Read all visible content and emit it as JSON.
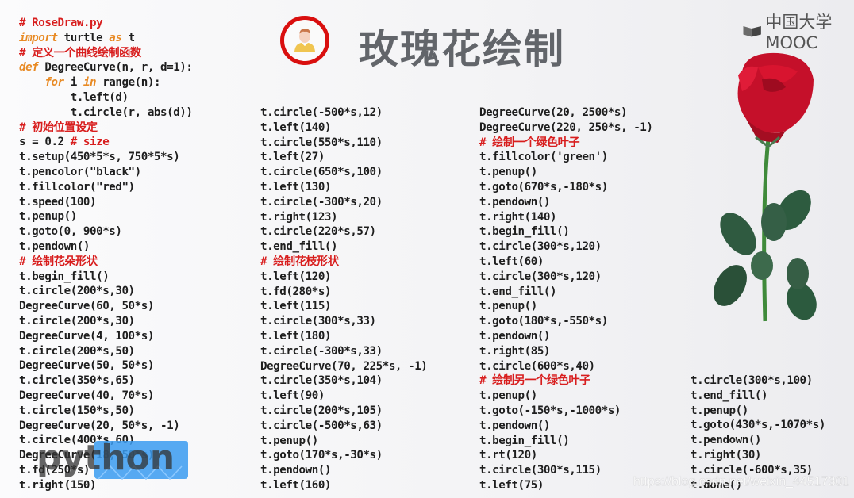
{
  "header": {
    "title": "玫瑰花绘制",
    "brand": "中国大学MOOC",
    "brand_icon": "mooc-logo-icon",
    "avatar_icon": "teacher-avatar-icon",
    "accent_color": "#d90f0f"
  },
  "code": {
    "columns": [
      [
        {
          "t": "comment",
          "text": "# RoseDraw.py"
        },
        {
          "t": "import",
          "text": "import turtle as t"
        },
        {
          "t": "comment",
          "text": "# 定义一个曲线绘制函数"
        },
        {
          "t": "def",
          "text": "def DegreeCurve(n, r, d=1):"
        },
        {
          "t": "for",
          "text": "    for i in range(n):"
        },
        {
          "t": "code",
          "text": "        t.left(d)"
        },
        {
          "t": "code",
          "text": "        t.circle(r, abs(d))"
        },
        {
          "t": "comment",
          "text": "# 初始位置设定"
        },
        {
          "t": "size",
          "text": "s = 0.2 ",
          "comment": "# size"
        },
        {
          "t": "code",
          "text": "t.setup(450*5*s, 750*5*s)"
        },
        {
          "t": "code",
          "text": "t.pencolor(\"black\")"
        },
        {
          "t": "code",
          "text": "t.fillcolor(\"red\")"
        },
        {
          "t": "code",
          "text": "t.speed(100)"
        },
        {
          "t": "code",
          "text": "t.penup()"
        },
        {
          "t": "code",
          "text": "t.goto(0, 900*s)"
        },
        {
          "t": "code",
          "text": "t.pendown()"
        },
        {
          "t": "comment",
          "text": "# 绘制花朵形状"
        },
        {
          "t": "code",
          "text": "t.begin_fill()"
        },
        {
          "t": "code",
          "text": "t.circle(200*s,30)"
        },
        {
          "t": "code",
          "text": "DegreeCurve(60, 50*s)"
        },
        {
          "t": "code",
          "text": "t.circle(200*s,30)"
        },
        {
          "t": "code",
          "text": "DegreeCurve(4, 100*s)"
        },
        {
          "t": "code",
          "text": "t.circle(200*s,50)"
        },
        {
          "t": "code",
          "text": "DegreeCurve(50, 50*s)"
        },
        {
          "t": "code",
          "text": "t.circle(350*s,65)"
        },
        {
          "t": "code",
          "text": "DegreeCurve(40, 70*s)"
        },
        {
          "t": "code",
          "text": "t.circle(150*s,50)"
        },
        {
          "t": "code",
          "text": "DegreeCurve(20, 50*s, -1)"
        },
        {
          "t": "code",
          "text": "t.circle(400*s,60)"
        },
        {
          "t": "code",
          "text": "DegreeCurve(18, 50*s)"
        },
        {
          "t": "code",
          "text": "t.fd(250*s)"
        },
        {
          "t": "code",
          "text": "t.right(150)"
        }
      ],
      [
        {
          "t": "code",
          "text": "t.circle(-500*s,12)"
        },
        {
          "t": "code",
          "text": "t.left(140)"
        },
        {
          "t": "code",
          "text": "t.circle(550*s,110)"
        },
        {
          "t": "code",
          "text": "t.left(27)"
        },
        {
          "t": "code",
          "text": "t.circle(650*s,100)"
        },
        {
          "t": "code",
          "text": "t.left(130)"
        },
        {
          "t": "code",
          "text": "t.circle(-300*s,20)"
        },
        {
          "t": "code",
          "text": "t.right(123)"
        },
        {
          "t": "code",
          "text": "t.circle(220*s,57)"
        },
        {
          "t": "code",
          "text": "t.end_fill()"
        },
        {
          "t": "comment",
          "text": "# 绘制花枝形状"
        },
        {
          "t": "code",
          "text": "t.left(120)"
        },
        {
          "t": "code",
          "text": "t.fd(280*s)"
        },
        {
          "t": "code",
          "text": "t.left(115)"
        },
        {
          "t": "code",
          "text": "t.circle(300*s,33)"
        },
        {
          "t": "code",
          "text": "t.left(180)"
        },
        {
          "t": "code",
          "text": "t.circle(-300*s,33)"
        },
        {
          "t": "code",
          "text": "DegreeCurve(70, 225*s, -1)"
        },
        {
          "t": "code",
          "text": "t.circle(350*s,104)"
        },
        {
          "t": "code",
          "text": "t.left(90)"
        },
        {
          "t": "code",
          "text": "t.circle(200*s,105)"
        },
        {
          "t": "code",
          "text": "t.circle(-500*s,63)"
        },
        {
          "t": "code",
          "text": "t.penup()"
        },
        {
          "t": "code",
          "text": "t.goto(170*s,-30*s)"
        },
        {
          "t": "code",
          "text": "t.pendown()"
        },
        {
          "t": "code",
          "text": "t.left(160)"
        }
      ],
      [
        {
          "t": "code",
          "text": "DegreeCurve(20, 2500*s)"
        },
        {
          "t": "code",
          "text": "DegreeCurve(220, 250*s, -1)"
        },
        {
          "t": "comment",
          "text": "# 绘制一个绿色叶子"
        },
        {
          "t": "code",
          "text": "t.fillcolor('green')"
        },
        {
          "t": "code",
          "text": "t.penup()"
        },
        {
          "t": "code",
          "text": "t.goto(670*s,-180*s)"
        },
        {
          "t": "code",
          "text": "t.pendown()"
        },
        {
          "t": "code",
          "text": "t.right(140)"
        },
        {
          "t": "code",
          "text": "t.begin_fill()"
        },
        {
          "t": "code",
          "text": "t.circle(300*s,120)"
        },
        {
          "t": "code",
          "text": "t.left(60)"
        },
        {
          "t": "code",
          "text": "t.circle(300*s,120)"
        },
        {
          "t": "code",
          "text": "t.end_fill()"
        },
        {
          "t": "code",
          "text": "t.penup()"
        },
        {
          "t": "code",
          "text": "t.goto(180*s,-550*s)"
        },
        {
          "t": "code",
          "text": "t.pendown()"
        },
        {
          "t": "code",
          "text": "t.right(85)"
        },
        {
          "t": "code",
          "text": "t.circle(600*s,40)"
        },
        {
          "t": "comment",
          "text": "# 绘制另一个绿色叶子"
        },
        {
          "t": "code",
          "text": "t.penup()"
        },
        {
          "t": "code",
          "text": "t.goto(-150*s,-1000*s)"
        },
        {
          "t": "code",
          "text": "t.pendown()"
        },
        {
          "t": "code",
          "text": "t.begin_fill()"
        },
        {
          "t": "code",
          "text": "t.rt(120)"
        },
        {
          "t": "code",
          "text": "t.circle(300*s,115)"
        },
        {
          "t": "code",
          "text": "t.left(75)"
        }
      ],
      [
        {
          "t": "code",
          "text": "t.circle(300*s,100)"
        },
        {
          "t": "code",
          "text": "t.end_fill()"
        },
        {
          "t": "code",
          "text": "t.penup()"
        },
        {
          "t": "code",
          "text": "t.goto(430*s,-1070*s)"
        },
        {
          "t": "code",
          "text": "t.pendown()"
        },
        {
          "t": "code",
          "text": "t.right(30)"
        },
        {
          "t": "code",
          "text": "t.circle(-600*s,35)"
        },
        {
          "t": "code",
          "text": "t.done()"
        }
      ]
    ]
  },
  "images": {
    "rose": "red-rose-photo",
    "python_logo": "python-logo-watermark",
    "python_logo_text": "python"
  },
  "watermark": "https://blog.csdn.net/weixin_44517301"
}
